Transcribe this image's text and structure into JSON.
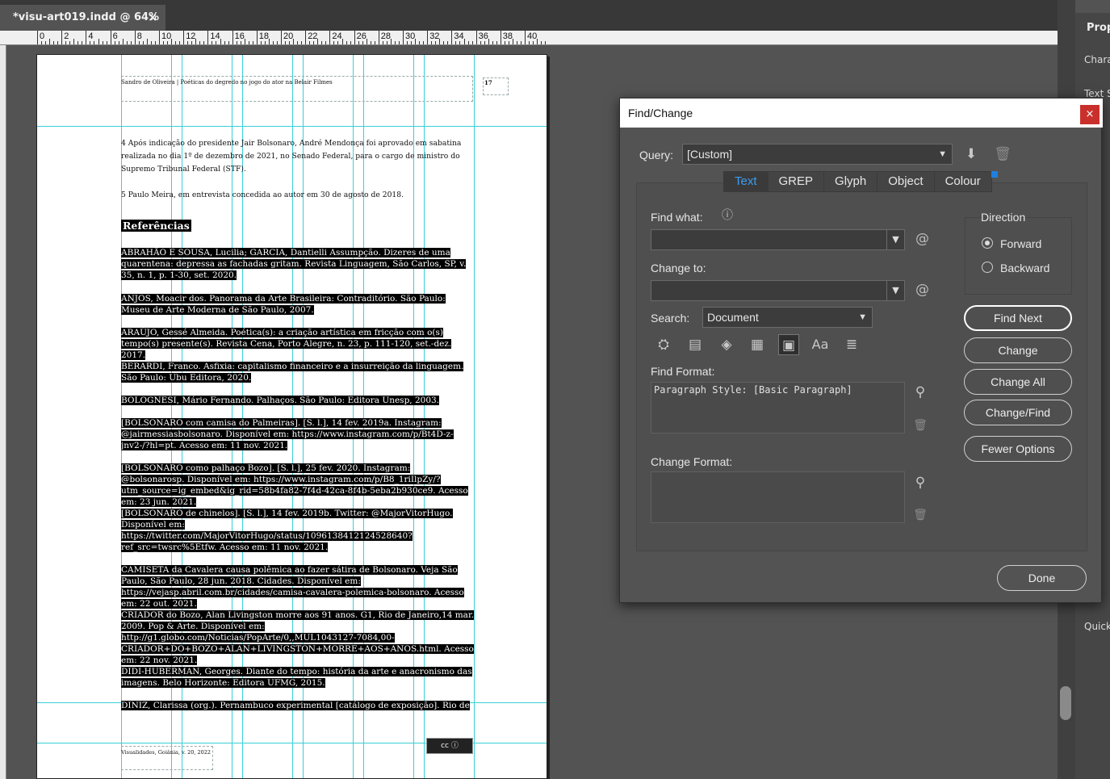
{
  "document_tab": {
    "title": "*visu-art019.indd @ 64%",
    "close": "×"
  },
  "ruler": {
    "labels": [
      "0",
      "2",
      "4",
      "6",
      "8",
      "10",
      "12",
      "14",
      "16",
      "18",
      "20",
      "22",
      "24",
      "26",
      "28",
      "30",
      "32",
      "34",
      "36",
      "38",
      "40"
    ]
  },
  "page": {
    "running_head": "Sandro de Oliveira | Poéticas do degredo no jogo do ator na Belair Filmes",
    "folio": "17",
    "note4": "4 Após indicação do presidente Jair Bolsonaro, André Mendonça foi aprovado em sabatina realizada no dia 1º de dezembro de 2021, no Senado Federal, para o cargo de ministro do Supremo Tribunal Federal (STF).",
    "note5": "5 Paulo Meira, em entrevista concedida ao autor em 30 de agosto de 2018.",
    "heading": "Referências",
    "references": [
      "ABRAHÃO E SOUSA, Lucilia; GARCIA, Dantielli Assumpção. Dizeres de uma quarentena: depressa as fachadas gritam. Revista Linguagem, São Carlos, SP, v. 35, n. 1, p. 1-30, set. 2020.",
      "ANJOS, Moacir dos. Panorama da Arte Brasileira: Contraditório. São Paulo: Museu de Arte Moderna de São Paulo, 2007.",
      "ARAÚJO, Gessé Almeida. Poética(s): a criação artística em fricção com o(s) tempo(s) presente(s). Revista Cena, Porto Alegre, n. 23, p. 111-120, set.-dez. 2017.",
      "BERARDI, Franco. Asfixia: capitalismo financeiro e a insurreição da linguagem. São Paulo: Ubu Editora, 2020.",
      "BOLOGNESI, Mário Fernando. Palhaços. São Paulo: Editora Unesp, 2003.",
      "[BOLSONARO com camisa do Palmeiras]. [S. l.], 14 fev. 2019a. Instagram: @jairmessiasbolsonaro. Disponível em: https://www.instagram.com/p/Bt4D-z-jnv2-/?hl=pt. Acesso em: 11 nov. 2021.",
      "[BOLSONARO como palhaço Bozo]. [S. l.], 25 fev. 2020. Instagram: @bolsonarosp. Disponível em: https://www.instagram.com/p/B8_1riIlpZy/?utm_source=ig_embed&ig_rid=58b4fa82-7f4d-42ca-8f4b-5eba2b930ce9. Acesso em: 23 jun. 2021.",
      "[BOLSONARO de chinelos]. [S. l.], 14 fev. 2019b. Twitter: @MajorVitorHugo. Disponível em: https://twitter.com/MajorVitorHugo/status/1096138412124528640?ref_src=twsrc%5Etfw. Acesso em: 11 nov. 2021.",
      "CAMISETA da Cavalera causa polêmica ao fazer sátira de Bolsonaro. Veja São Paulo, São Paulo, 28 jun. 2018. Cidades. Disponível em: https://vejasp.abril.com.br/cidades/camisa-cavalera-polemica-bolsonaro. Acesso em: 22 out. 2021.",
      "CRIADOR do Bozo, Alan Livingston morre aos 91 anos. G1, Rio de Janeiro,14 mar. 2009. Pop & Arte. Disponível em: http://g1.globo.com/Noticias/PopArte/0,,MUL1043127-7084,00-CRIADOR+DO+BOZO+ALAN+LIVINGSTON+MORRE+AOS+ANOS.html. Acesso em: 22 nov. 2021.",
      "DIDI-HUBERMAN, Georges. Diante do tempo: história da arte e anacronismo das imagens. Belo Horizonte: Editora UFMG, 2015.",
      "DINIZ, Clarissa (org.). Pernambuco experimental [catálogo de exposição]. Rio de"
    ],
    "footer": "Visualidades, Goiânia, v. 20, 2022",
    "cc_label": "cc ⓘ"
  },
  "right_panel": {
    "title": "Prop",
    "items": [
      "Chara",
      "Text S",
      "Quick"
    ]
  },
  "dialog": {
    "title": "Find/Change",
    "close": "×",
    "query_label": "Query:",
    "query_value": "[Custom]",
    "tabs": [
      "Text",
      "GREP",
      "Glyph",
      "Object",
      "Colour"
    ],
    "active_tab": "Text",
    "find_what_label": "Find what:",
    "find_what_value": "",
    "change_to_label": "Change to:",
    "change_to_value": "",
    "search_label": "Search:",
    "search_value": "Document",
    "find_format_label": "Find Format:",
    "find_format_value": "Paragraph Style: [Basic Paragraph]",
    "change_format_label": "Change Format:",
    "change_format_value": "",
    "direction_label": "Direction",
    "direction_options": [
      "Forward",
      "Backward"
    ],
    "direction_selected": "Forward",
    "buttons": {
      "find_next": "Find Next",
      "change": "Change",
      "change_all": "Change All",
      "change_find": "Change/Find",
      "fewer_options": "Fewer Options",
      "done": "Done"
    },
    "icons": {
      "save_query": "save-query-icon",
      "delete_query": "trash-icon",
      "special_chars": "at-sign-icon",
      "info": "info-icon"
    }
  }
}
